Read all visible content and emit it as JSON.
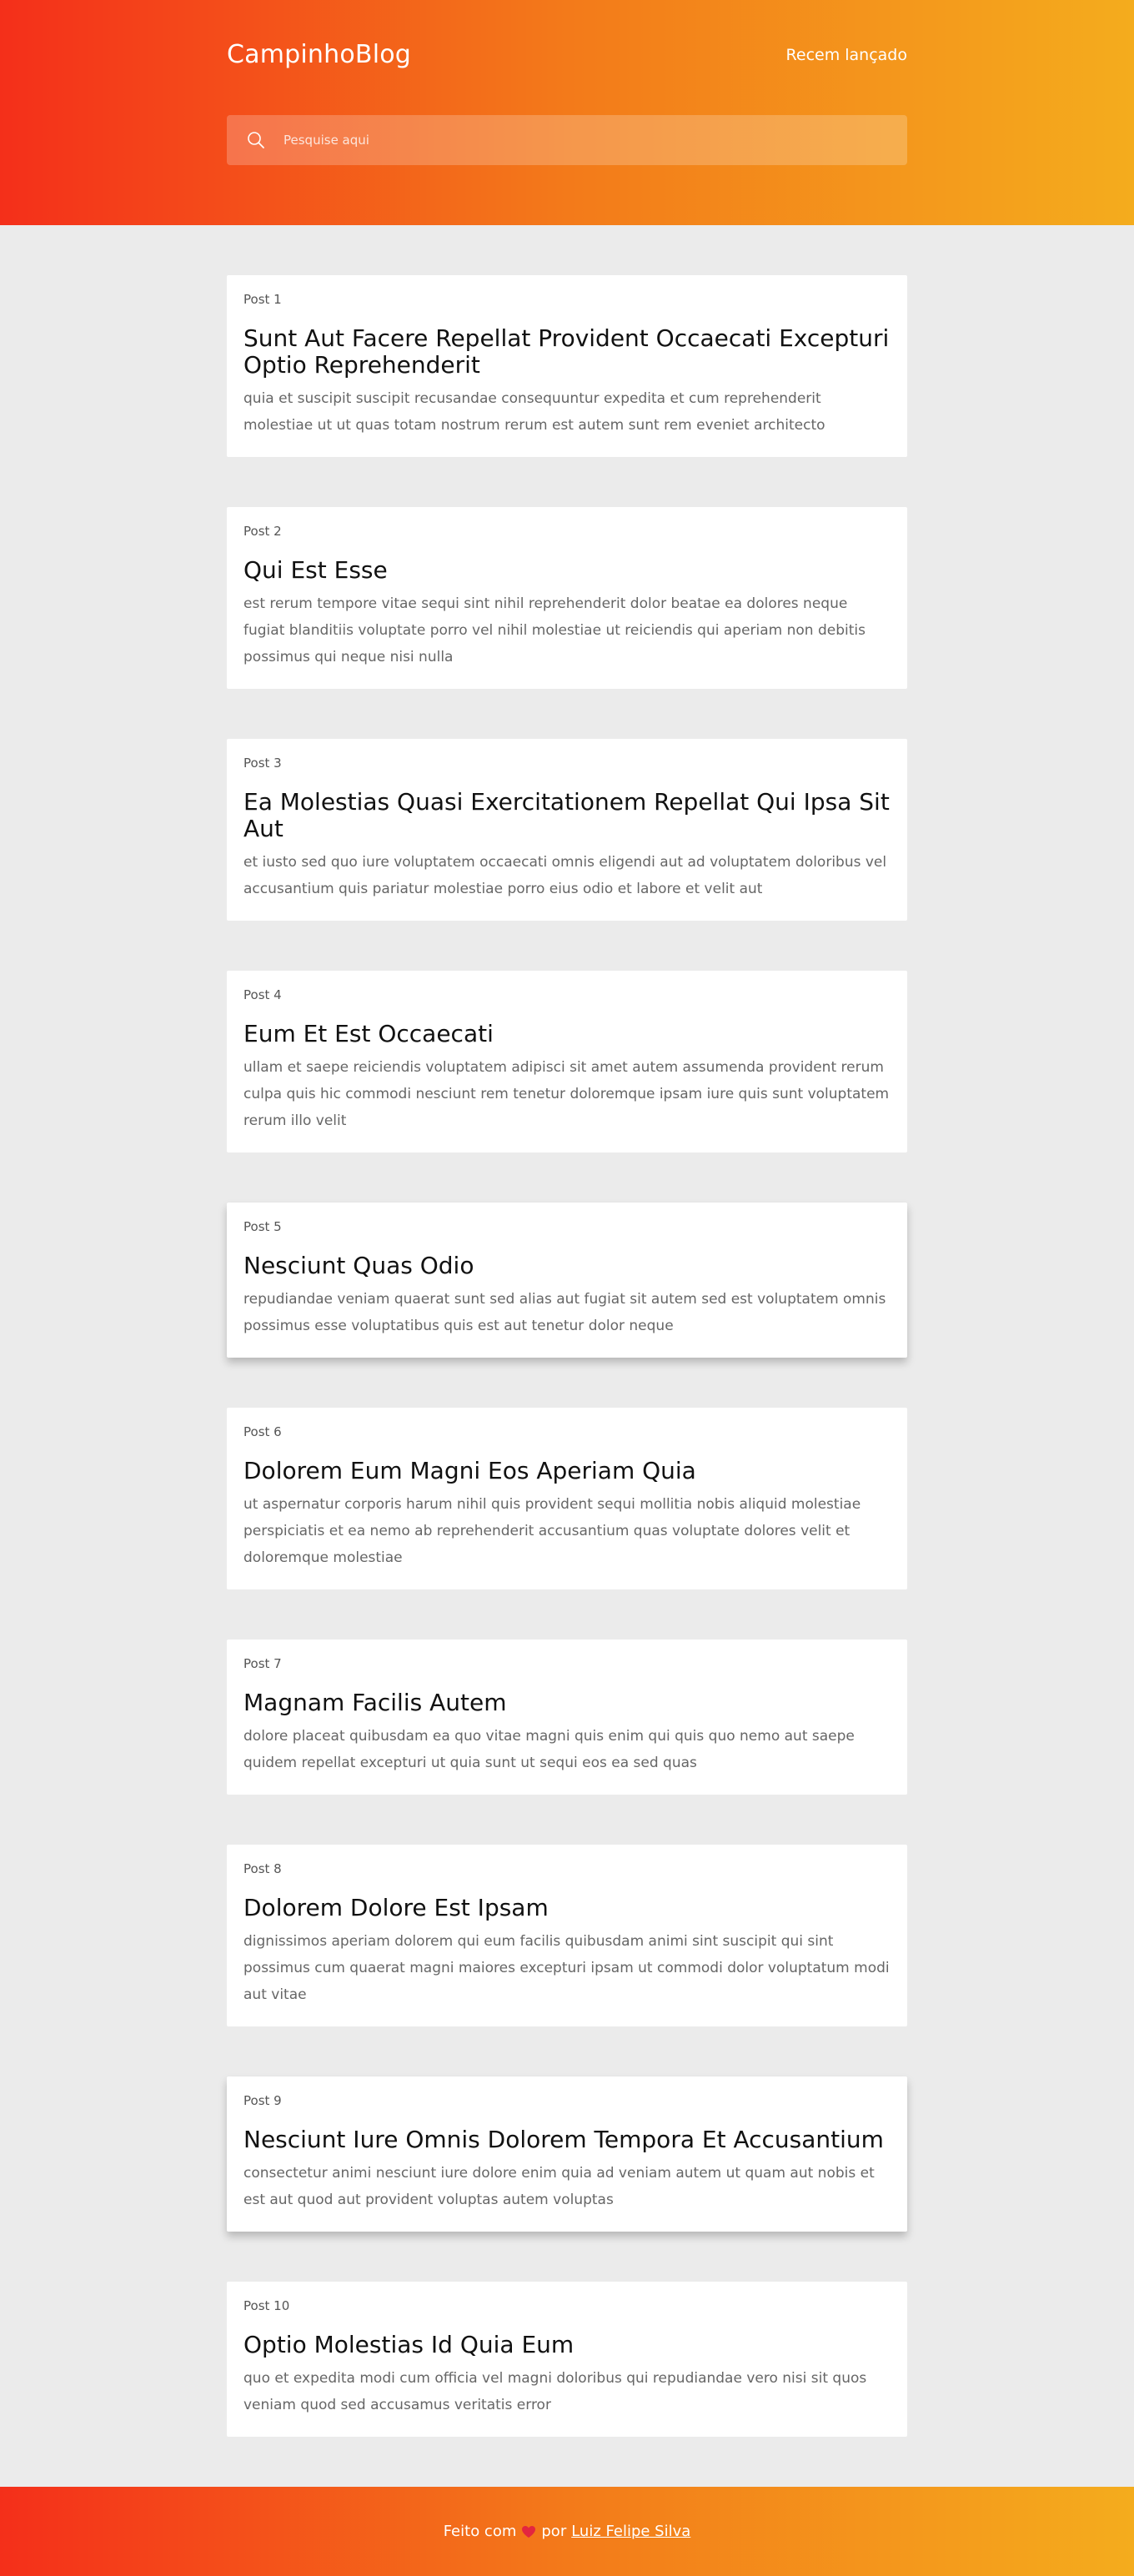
{
  "header": {
    "brand": "CampinhoBlog",
    "nav_link": "Recem lançado",
    "search_placeholder": "Pesquise aqui"
  },
  "posts": [
    {
      "number": "Post 1",
      "title": "Sunt Aut Facere Repellat Provident Occaecati Excepturi Optio Reprehenderit",
      "body": "quia et suscipit suscipit recusandae consequuntur expedita et cum reprehenderit molestiae ut ut quas totam nostrum rerum est autem sunt rem eveniet architecto"
    },
    {
      "number": "Post 2",
      "title": "Qui Est Esse",
      "body": "est rerum tempore vitae sequi sint nihil reprehenderit dolor beatae ea dolores neque fugiat blanditiis voluptate porro vel nihil molestiae ut reiciendis qui aperiam non debitis possimus qui neque nisi nulla"
    },
    {
      "number": "Post 3",
      "title": "Ea Molestias Quasi Exercitationem Repellat Qui Ipsa Sit Aut",
      "body": "et iusto sed quo iure voluptatem occaecati omnis eligendi aut ad voluptatem doloribus vel accusantium quis pariatur molestiae porro eius odio et labore et velit aut"
    },
    {
      "number": "Post 4",
      "title": "Eum Et Est Occaecati",
      "body": "ullam et saepe reiciendis voluptatem adipisci sit amet autem assumenda provident rerum culpa quis hic commodi nesciunt rem tenetur doloremque ipsam iure quis sunt voluptatem rerum illo velit"
    },
    {
      "number": "Post 5",
      "title": "Nesciunt Quas Odio",
      "body": "repudiandae veniam quaerat sunt sed alias aut fugiat sit autem sed est voluptatem omnis possimus esse voluptatibus quis est aut tenetur dolor neque"
    },
    {
      "number": "Post 6",
      "title": "Dolorem Eum Magni Eos Aperiam Quia",
      "body": "ut aspernatur corporis harum nihil quis provident sequi mollitia nobis aliquid molestiae perspiciatis et ea nemo ab reprehenderit accusantium quas voluptate dolores velit et doloremque molestiae"
    },
    {
      "number": "Post 7",
      "title": "Magnam Facilis Autem",
      "body": "dolore placeat quibusdam ea quo vitae magni quis enim qui quis quo nemo aut saepe quidem repellat excepturi ut quia sunt ut sequi eos ea sed quas"
    },
    {
      "number": "Post 8",
      "title": "Dolorem Dolore Est Ipsam",
      "body": "dignissimos aperiam dolorem qui eum facilis quibusdam animi sint suscipit qui sint possimus cum quaerat magni maiores excepturi ipsam ut commodi dolor voluptatum modi aut vitae"
    },
    {
      "number": "Post 9",
      "title": "Nesciunt Iure Omnis Dolorem Tempora Et Accusantium",
      "body": "consectetur animi nesciunt iure dolore enim quia ad veniam autem ut quam aut nobis et est aut quod aut provident voluptas autem voluptas"
    },
    {
      "number": "Post 10",
      "title": "Optio Molestias Id Quia Eum",
      "body": "quo et expedita modi cum officia vel magni doloribus qui repudiandae vero nisi sit quos veniam quod sed accusamus veritatis error"
    }
  ],
  "footer": {
    "made_with": "Feito com",
    "by": "por",
    "author": "Luiz Felipe Silva",
    "heart_icon": "heart-icon"
  },
  "colors": {
    "gradient_start": "#f42f1a",
    "gradient_mid": "#f37a1a",
    "gradient_end": "#f4ac1d",
    "heart": "#e3263f"
  }
}
